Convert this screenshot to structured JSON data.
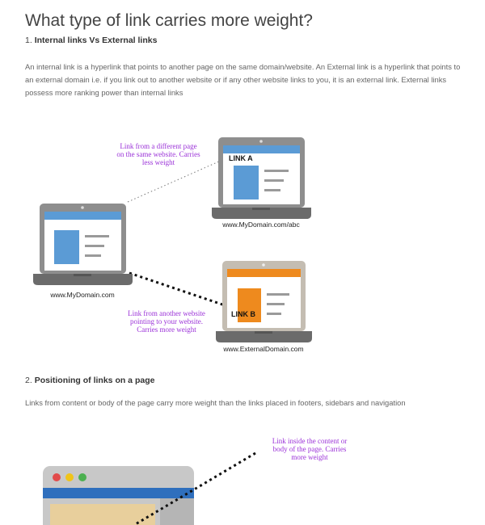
{
  "heading": "What type of link carries more weight?",
  "section1": {
    "number": "1.",
    "title": "Internal links Vs External links",
    "text": "An internal link is a hyperlink that points to another page on the same domain/website. An External link is a hyperlink that points to an external domain i.e. if you link out to another website or if any other website links to you, it is an external link. External links possess more ranking power than internal links"
  },
  "diagram1": {
    "note_internal": [
      "Link from a different page",
      "on the same website. Carries",
      "less weight"
    ],
    "note_external": [
      "Link from another website",
      "pointing to your website.",
      "Carries more weight"
    ],
    "link_a": "LINK A",
    "link_b": "LINK B",
    "url_main": "www.MyDomain.com",
    "url_abc": "www.MyDomain.com/abc",
    "url_external": "www.ExternalDomain.com",
    "colors": {
      "blue": "#5b9bd5",
      "orange": "#ee8a1e",
      "purple": "#9b32d8",
      "laptop": "#8e8e8e"
    }
  },
  "section2": {
    "number": "2.",
    "title": "Positioning of links on a page",
    "text": "Links from content or body of the page carry more weight than the links placed in footers, sidebars and navigation"
  },
  "diagram2": {
    "note_content": [
      "Link inside the content or",
      "body of the page. Carries",
      "more weight"
    ]
  }
}
